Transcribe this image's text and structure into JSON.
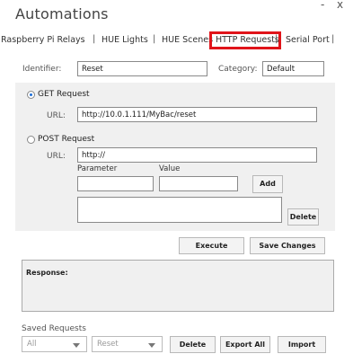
{
  "window": {
    "title": "Automations",
    "minimize": "-",
    "close": "x"
  },
  "tabs": [
    {
      "label": "Raspberry Pi Relays"
    },
    {
      "label": "HUE Lights"
    },
    {
      "label": "HUE Scenes"
    },
    {
      "label": "HTTP Requests"
    },
    {
      "label": "Serial Port"
    }
  ],
  "tab_separator": "|",
  "form": {
    "identifier_label": "Identifier:",
    "identifier_value": "Reset",
    "category_label": "Category:",
    "category_value": "Default"
  },
  "get_request": {
    "label": "GET Request",
    "url_label": "URL:",
    "url_value": "http://10.0.1.111/MyBac/reset",
    "selected": true
  },
  "post_request": {
    "label": "POST Request",
    "url_label": "URL:",
    "url_value": "http://",
    "parameter_label": "Parameter",
    "value_label": "Value",
    "parameter_value": "",
    "value_value": "",
    "add_label": "Add",
    "delete_label": "Delete",
    "selected": false
  },
  "actions": {
    "execute_label": "Execute",
    "save_label": "Save Changes"
  },
  "response": {
    "label": "Response:"
  },
  "saved": {
    "label": "Saved Requests",
    "category_select": "All",
    "request_select": "Reset",
    "delete_label": "Delete",
    "export_label": "Export All",
    "import_label": "Import"
  },
  "colors": {
    "active_tab_border": "#e0141a",
    "radio_selected": "#1e6fd9",
    "panel_bg": "#f0f0f0"
  }
}
